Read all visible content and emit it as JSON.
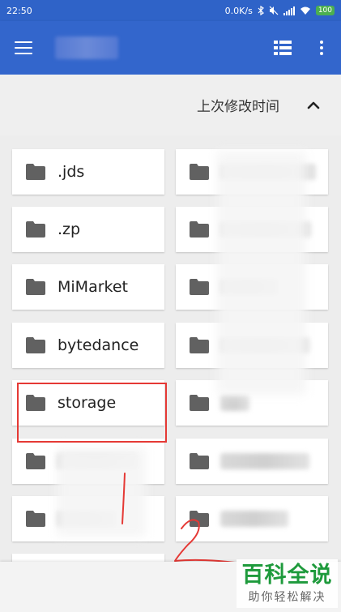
{
  "status_bar": {
    "time": "22:50",
    "network_speed": "0.0K/s",
    "battery": "100"
  },
  "app_bar": {
    "menu_icon": "hamburger-menu-icon",
    "view_icon": "list-view-icon",
    "more_icon": "more-vert-icon"
  },
  "sort": {
    "label": "上次修改时间",
    "direction_icon": "chevron-up-icon"
  },
  "folders_left": [
    ".jds",
    ".zp",
    "MiMarket",
    "bytedance",
    "storage"
  ],
  "watermark": {
    "main": "百科全说",
    "sub": "助你轻松解决"
  },
  "colors": {
    "app_bar": "#3366cc",
    "status_bar": "#2f63c8",
    "folder_icon": "#616161",
    "highlight": "#e53935",
    "watermark": "#1e9a3c"
  }
}
